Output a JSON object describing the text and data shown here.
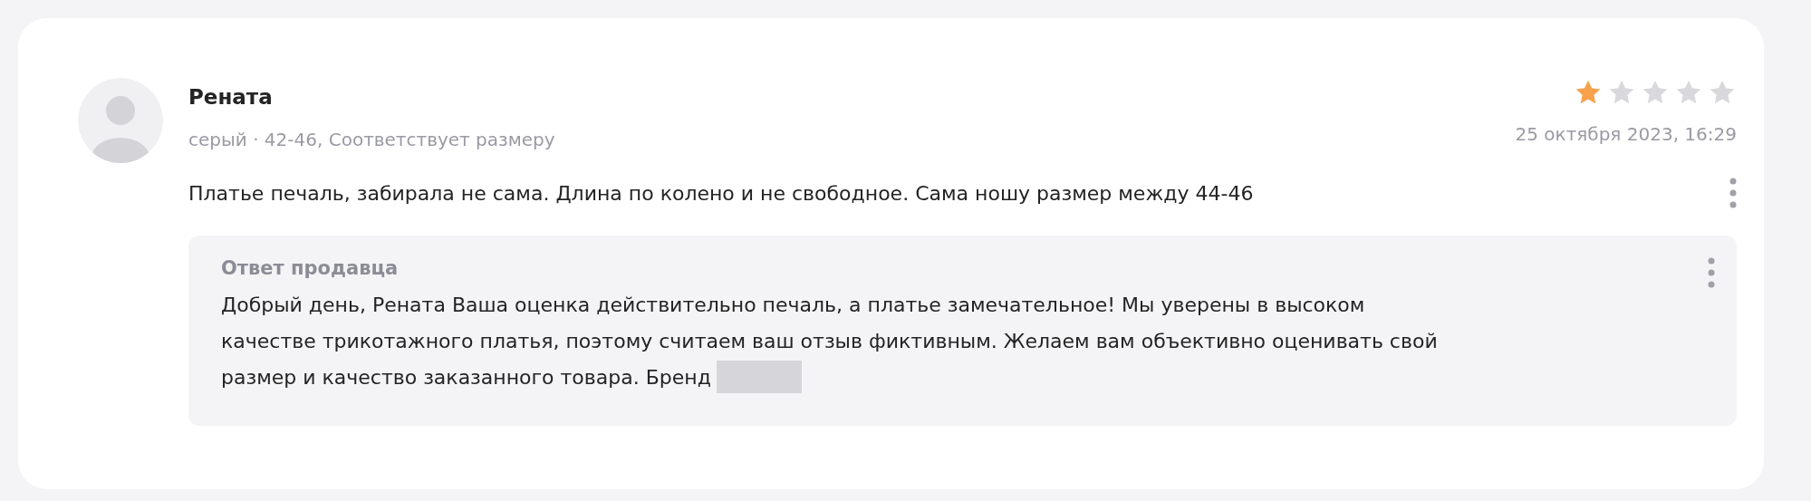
{
  "review": {
    "author": "Рената",
    "details": "серый · 42-46, Соответствует размеру",
    "stars": 1,
    "date": "25 октября 2023, 16:29",
    "text": "Платье печаль, забирала не сама. Длина по колено и не свободное. Сама ношу размер между 44-46",
    "seller_reply": {
      "title": "Ответ продавца",
      "lines": [
        "Добрый день, Рената Ваша оценка действительно печаль, а платье замечательное! Мы уверены в высоком",
        "качестве трикотажного платья, поэтому считаем ваш отзыв фиктивным. Желаем вам объективно оценивать свой",
        "размер и качество заказанного товара. Бренд"
      ]
    }
  }
}
